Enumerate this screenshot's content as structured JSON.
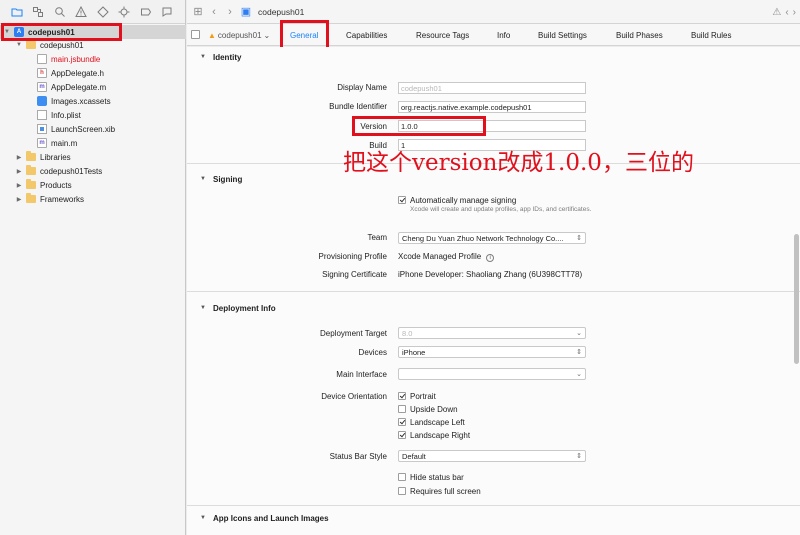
{
  "navigator": {
    "toolbar_icons": [
      "folder-icon",
      "symbol-icon",
      "search-icon",
      "warning-icon",
      "test-icon",
      "debug-icon",
      "breakpoint-icon",
      "report-icon"
    ],
    "tree": [
      {
        "label": "codepush01",
        "icon": "project-icon",
        "expanded": true
      },
      {
        "label": "codepush01",
        "icon": "folder-icon",
        "expanded": true
      },
      {
        "label": "main.jsbundle",
        "icon": "file-icon",
        "color": "#e0101d"
      },
      {
        "label": "AppDelegate.h",
        "icon": "h-file-icon",
        "glyph": "h"
      },
      {
        "label": "AppDelegate.m",
        "icon": "m-file-icon",
        "glyph": "m"
      },
      {
        "label": "Images.xcassets",
        "icon": "asset-catalog-icon"
      },
      {
        "label": "Info.plist",
        "icon": "plist-icon"
      },
      {
        "label": "LaunchScreen.xib",
        "icon": "xib-icon"
      },
      {
        "label": "main.m",
        "icon": "m-file-icon",
        "glyph": "m"
      },
      {
        "label": "Libraries",
        "icon": "folder-icon",
        "expanded": false
      },
      {
        "label": "codepush01Tests",
        "icon": "folder-icon",
        "expanded": false
      },
      {
        "label": "Products",
        "icon": "folder-icon",
        "expanded": false
      },
      {
        "label": "Frameworks",
        "icon": "folder-icon",
        "expanded": false
      }
    ]
  },
  "editor": {
    "jump_file": "codepush01",
    "target": "codepush01",
    "tabs": [
      "General",
      "Capabilities",
      "Resource Tags",
      "Info",
      "Build Settings",
      "Build Phases",
      "Build Rules"
    ],
    "active_tab": "General"
  },
  "identity": {
    "title": "Identity",
    "display_name_label": "Display Name",
    "display_name_placeholder": "codepush01",
    "bundle_id_label": "Bundle Identifier",
    "bundle_id_value": "org.reactjs.native.example.codepush01",
    "version_label": "Version",
    "version_value": "1.0.0",
    "build_label": "Build",
    "build_value": "1"
  },
  "signing": {
    "title": "Signing",
    "auto_label": "Automatically manage signing",
    "auto_checked": true,
    "auto_hint": "Xcode will create and update profiles, app IDs, and certificates.",
    "team_label": "Team",
    "team_value": "Cheng Du Yuan Zhuo Network Technology Co....",
    "profile_label": "Provisioning Profile",
    "profile_value": "Xcode Managed Profile",
    "cert_label": "Signing Certificate",
    "cert_value": "iPhone Developer: Shaoliang Zhang (6U398CTT78)"
  },
  "deployment": {
    "title": "Deployment Info",
    "target_label": "Deployment Target",
    "target_value": "8.0",
    "devices_label": "Devices",
    "devices_value": "iPhone",
    "main_interface_label": "Main Interface",
    "main_interface_value": "",
    "orientation_label": "Device Orientation",
    "orientations": [
      {
        "label": "Portrait",
        "checked": true
      },
      {
        "label": "Upside Down",
        "checked": false
      },
      {
        "label": "Landscape Left",
        "checked": true
      },
      {
        "label": "Landscape Right",
        "checked": true
      }
    ],
    "status_bar_label": "Status Bar Style",
    "status_bar_value": "Default",
    "hide_status_bar": {
      "label": "Hide status bar",
      "checked": false
    },
    "requires_full_screen": {
      "label": "Requires full screen",
      "checked": false
    }
  },
  "app_icons": {
    "title": "App Icons and Launch Images"
  },
  "annotation": {
    "text": "把这个version改成1.0.0，三位的",
    "color": "#e0101d"
  }
}
